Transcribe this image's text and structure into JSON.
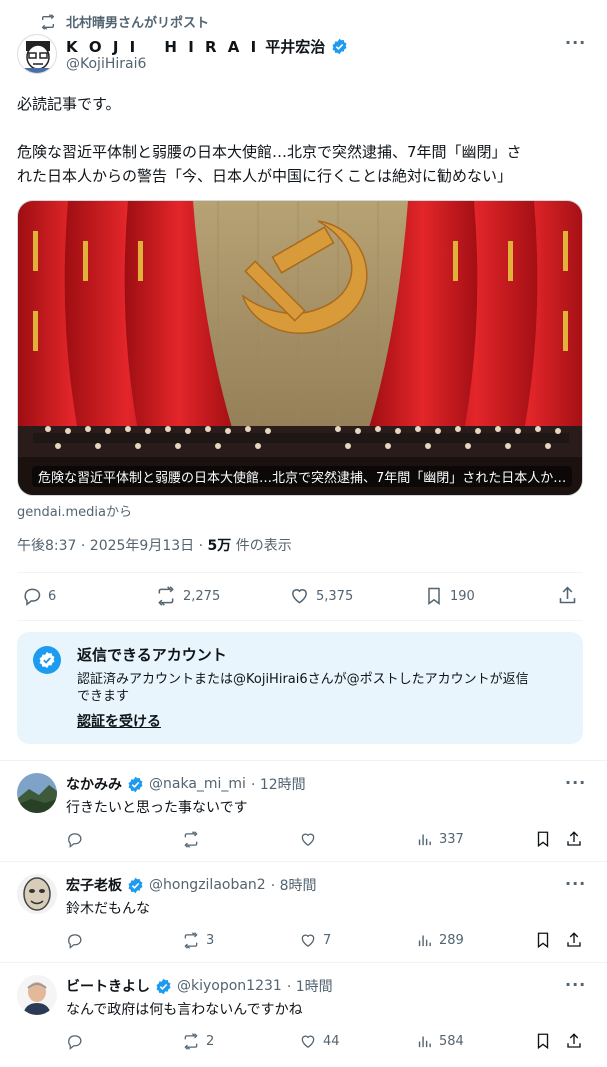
{
  "repost": {
    "label": "北村晴男さんがリポスト"
  },
  "post": {
    "author_name_latin": "K O J I　 H I R A I",
    "author_name_jp": "平井宏治",
    "handle": "@KojiHirai6",
    "body_line1": "必読記事です。",
    "body_line2": "危険な習近平体制と弱腰の日本大使館…北京で突然逮捕、7年間「幽閉」さ",
    "body_line3": "れた日本人からの警告「今、日本人が中国に行くことは絶対に勧めない」",
    "card_caption": "危険な習近平体制と弱腰の日本大使館…北京で突然逮捕、7年間「幽閉」された日本人か…",
    "card_source": "gendai.mediaから",
    "timestamp": "午後8:37 · 2025年9月13日 · ",
    "views_count": "5万",
    "views_label": " 件の表示",
    "stats": {
      "replies": "6",
      "reposts": "2,275",
      "likes": "5,375",
      "bookmarks": "190"
    }
  },
  "reply_notice": {
    "title": "返信できるアカウント",
    "line1": "認証済みアカウントまたは@KojiHirai6さんが@ポストしたアカウントが返信",
    "line2": "できます",
    "cta": "認証を受ける"
  },
  "replies": [
    {
      "name": "なかみみ",
      "handle": "@naka_mi_mi",
      "time": "· 12時間",
      "text": "行きたいと思った事ないです",
      "reposts": "",
      "likes": "",
      "views": "337"
    },
    {
      "name": "宏子老板",
      "handle": "@hongzilaoban2",
      "time": "· 8時間",
      "text": "鈴木だもんな",
      "reposts": "3",
      "likes": "7",
      "views": "289"
    },
    {
      "name": "ビートきよし",
      "handle": "@kiyopon1231",
      "time": "· 1時間",
      "text": "なんで政府は何も言わないんですかね",
      "reposts": "2",
      "likes": "44",
      "views": "584"
    }
  ],
  "colors": {
    "accent": "#1d9bf0",
    "notice_bg": "#e8f5fd",
    "text": "#0f1419",
    "muted": "#536471"
  }
}
